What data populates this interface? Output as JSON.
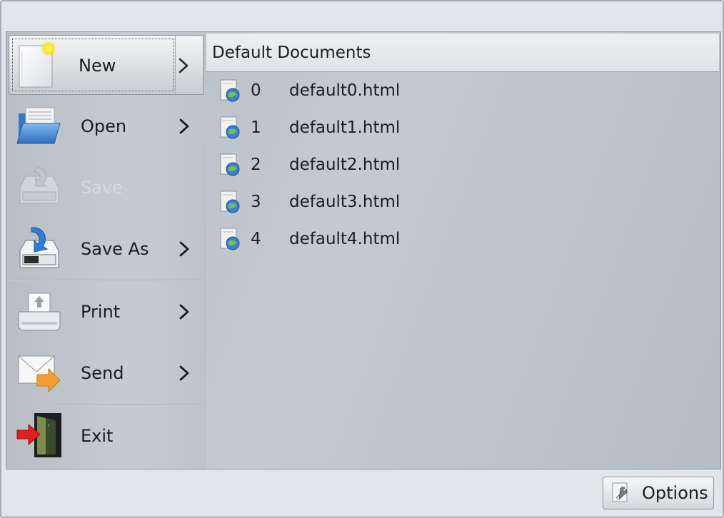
{
  "menu": {
    "items": [
      {
        "label": "New",
        "icon": "new-document-icon",
        "submenu": true,
        "selected": true,
        "enabled": true
      },
      {
        "label": "Open",
        "icon": "open-folder-icon",
        "submenu": true,
        "enabled": true
      },
      {
        "label": "Save",
        "icon": "save-disk-icon",
        "submenu": false,
        "enabled": false
      },
      {
        "label": "Save As",
        "icon": "save-as-icon",
        "submenu": true,
        "enabled": true
      },
      {
        "label": "Print",
        "icon": "printer-icon",
        "submenu": true,
        "enabled": true
      },
      {
        "label": "Send",
        "icon": "send-mail-icon",
        "submenu": true,
        "enabled": true
      },
      {
        "label": "Exit",
        "icon": "exit-door-icon",
        "submenu": false,
        "enabled": true
      }
    ]
  },
  "documents": {
    "header": "Default Documents",
    "rows": [
      {
        "num": "0",
        "name": "default0.html"
      },
      {
        "num": "1",
        "name": "default1.html"
      },
      {
        "num": "2",
        "name": "default2.html"
      },
      {
        "num": "3",
        "name": "default3.html"
      },
      {
        "num": "4",
        "name": "default4.html"
      }
    ]
  },
  "footer": {
    "options_label": "Options"
  },
  "colors": {
    "window_bg": "#e2e5e9",
    "panel_bg": "#c4cad1",
    "folder_blue": "#4a8fd4",
    "send_orange": "#f0a030",
    "exit_red": "#e02020",
    "disabled_text": "#d6d9dd"
  }
}
